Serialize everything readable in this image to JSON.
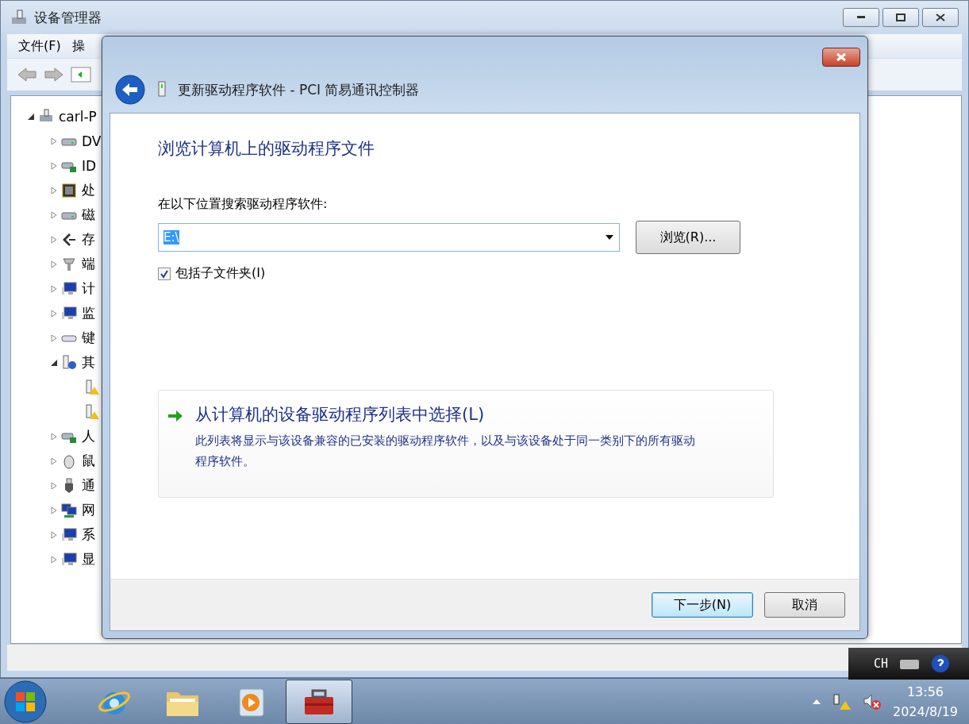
{
  "main_window": {
    "title": "设备管理器",
    "menu": [
      "文件(F)",
      "操"
    ],
    "tree": [
      {
        "label": "carl-P",
        "kind": "computer",
        "expanded": true,
        "children": [
          {
            "label": "DV",
            "kind": "disk",
            "expanded": false
          },
          {
            "label": "ID",
            "kind": "controller",
            "expanded": false
          },
          {
            "label": "处",
            "kind": "chip",
            "expanded": false
          },
          {
            "label": "磁",
            "kind": "disk",
            "expanded": false
          },
          {
            "label": "存",
            "kind": "storage",
            "expanded": false
          },
          {
            "label": "端",
            "kind": "port",
            "expanded": false
          },
          {
            "label": "计",
            "kind": "monitor",
            "expanded": false
          },
          {
            "label": "监",
            "kind": "monitor",
            "expanded": false
          },
          {
            "label": "键",
            "kind": "keyboard",
            "expanded": false
          },
          {
            "label": "其",
            "kind": "unknown",
            "expanded": true,
            "children": [
              {
                "kind": "warning"
              },
              {
                "kind": "warning"
              }
            ]
          },
          {
            "label": "人",
            "kind": "controller",
            "expanded": false
          },
          {
            "label": "鼠",
            "kind": "mouse",
            "expanded": false
          },
          {
            "label": "通",
            "kind": "usb",
            "expanded": false
          },
          {
            "label": "网",
            "kind": "network",
            "expanded": false
          },
          {
            "label": "系",
            "kind": "monitor",
            "expanded": false
          },
          {
            "label": "显",
            "kind": "monitor",
            "expanded": false
          }
        ]
      }
    ]
  },
  "dialog": {
    "title": "更新驱动程序软件 - PCI 简易通讯控制器",
    "heading": "浏览计算机上的驱动程序文件",
    "search_label": "在以下位置搜索驱动程序软件:",
    "path_field": {
      "value": "E:\\"
    },
    "browse_button": "浏览(R)...",
    "include_subfolders": {
      "label": "包括子文件夹(I)",
      "checked": true
    },
    "option_link": {
      "title": "从计算机的设备驱动程序列表中选择(L)",
      "description": "此列表将显示与该设备兼容的已安装的驱动程序软件，以及与该设备处于同一类别下的所有驱动程序软件。"
    },
    "buttons": [
      {
        "label": "下一步(N)",
        "default": true
      },
      {
        "label": "取消",
        "default": false
      }
    ]
  },
  "language_bar": {
    "language": "CH"
  },
  "taskbar": {
    "apps": [
      {
        "kind": "browser",
        "selected": false
      },
      {
        "kind": "folder",
        "selected": false
      },
      {
        "kind": "media",
        "selected": false
      },
      {
        "kind": "toolbox",
        "selected": true
      }
    ],
    "time": "13:56",
    "date": "2024/8/19"
  }
}
